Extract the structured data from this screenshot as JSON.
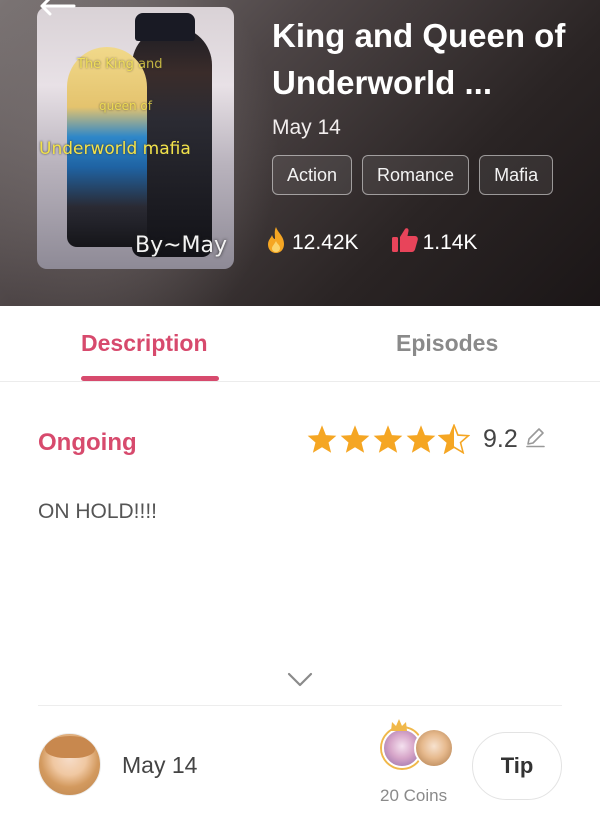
{
  "header": {
    "title": "King and Queen of Underworld ...",
    "date": "May 14",
    "tags": [
      "Action",
      "Romance",
      "Mafia"
    ],
    "views": "12.42K",
    "likes": "1.14K"
  },
  "cover": {
    "line1": "The King and",
    "line2": "queen of",
    "line3": "Underworld mafia",
    "author_mark": "By~May"
  },
  "tabs": {
    "description": "Description",
    "episodes": "Episodes",
    "active": "Description"
  },
  "description": {
    "status": "Ongoing",
    "rating_value": "9.2",
    "stars": 4.5,
    "text": "ON HOLD!!!!"
  },
  "footer": {
    "date": "May 14",
    "coins": "20 Coins",
    "tip_label": "Tip"
  },
  "colors": {
    "accent": "#d74a6d",
    "star": "#f5a623",
    "fire": "#f5a623",
    "thumb": "#e8445a"
  },
  "icons": [
    "back-arrow-icon",
    "fire-icon",
    "thumbs-up-icon",
    "star-icon",
    "edit-icon",
    "chevron-down-icon",
    "crown-icon"
  ]
}
